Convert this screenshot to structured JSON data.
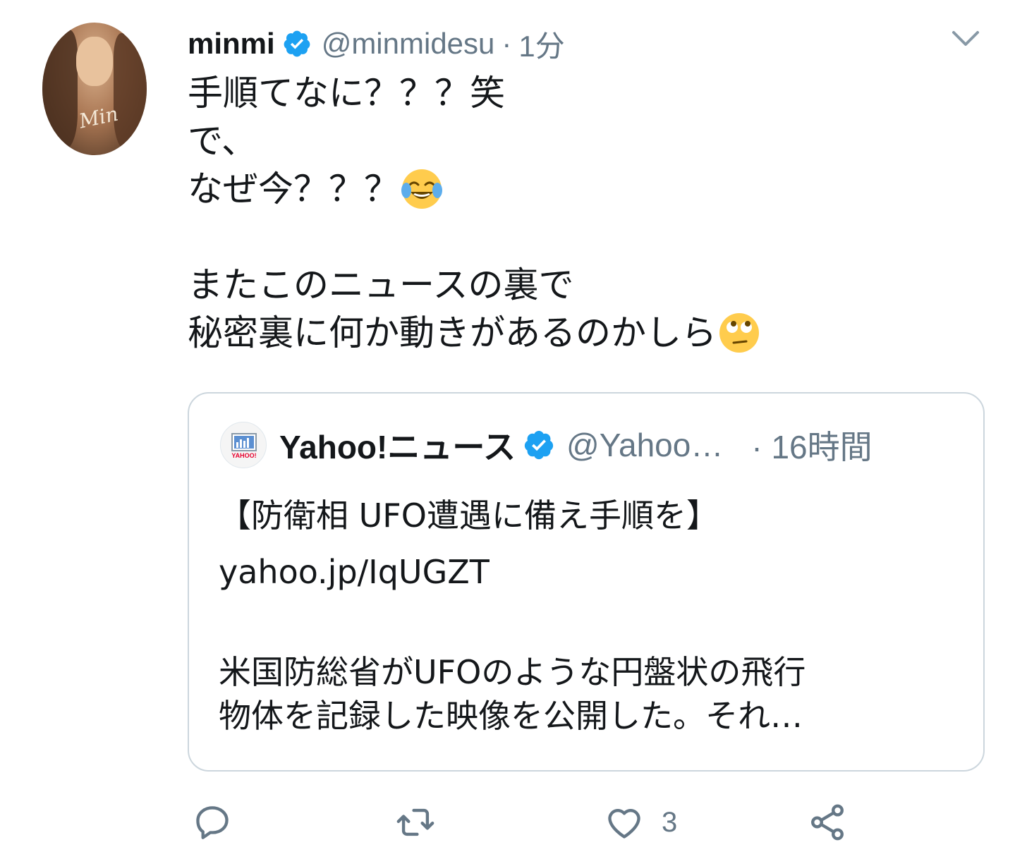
{
  "author": {
    "name": "minmi",
    "handle": "@minmidesu",
    "separator": "·",
    "time": "1分",
    "verified": true,
    "avatar_signature": "Min"
  },
  "tweet": {
    "lines": [
      "手順てなに？？？笑",
      "で、",
      "なぜ今？？？",
      "",
      "またこのニュースの裏で",
      "秘密裏に何か動きがあるのかしら"
    ],
    "emoji_1": "face-with-tears-of-joy",
    "emoji_2": "face-with-rolling-eyes"
  },
  "quoted": {
    "name": "Yahoo!ニュース",
    "handle": "@Yahoo…",
    "time": "· 16時間",
    "verified": true,
    "logo_text": "YAHOO!",
    "lines": [
      "【防衛相 UFO遭遇に備え手順を】",
      "yahoo.jp/IqUGZT",
      "",
      "米国防総省がUFOのような円盤状の飛行",
      "物体を記録した映像を公開した。それ…"
    ]
  },
  "actions": {
    "reply_icon": "reply-icon",
    "retweet_icon": "retweet-icon",
    "like_icon": "heart-icon",
    "like_count": "3",
    "share_icon": "share-icon"
  },
  "colors": {
    "verified_blue": "#1da1f2",
    "secondary_text": "#657786",
    "border": "#ccd6dd"
  }
}
